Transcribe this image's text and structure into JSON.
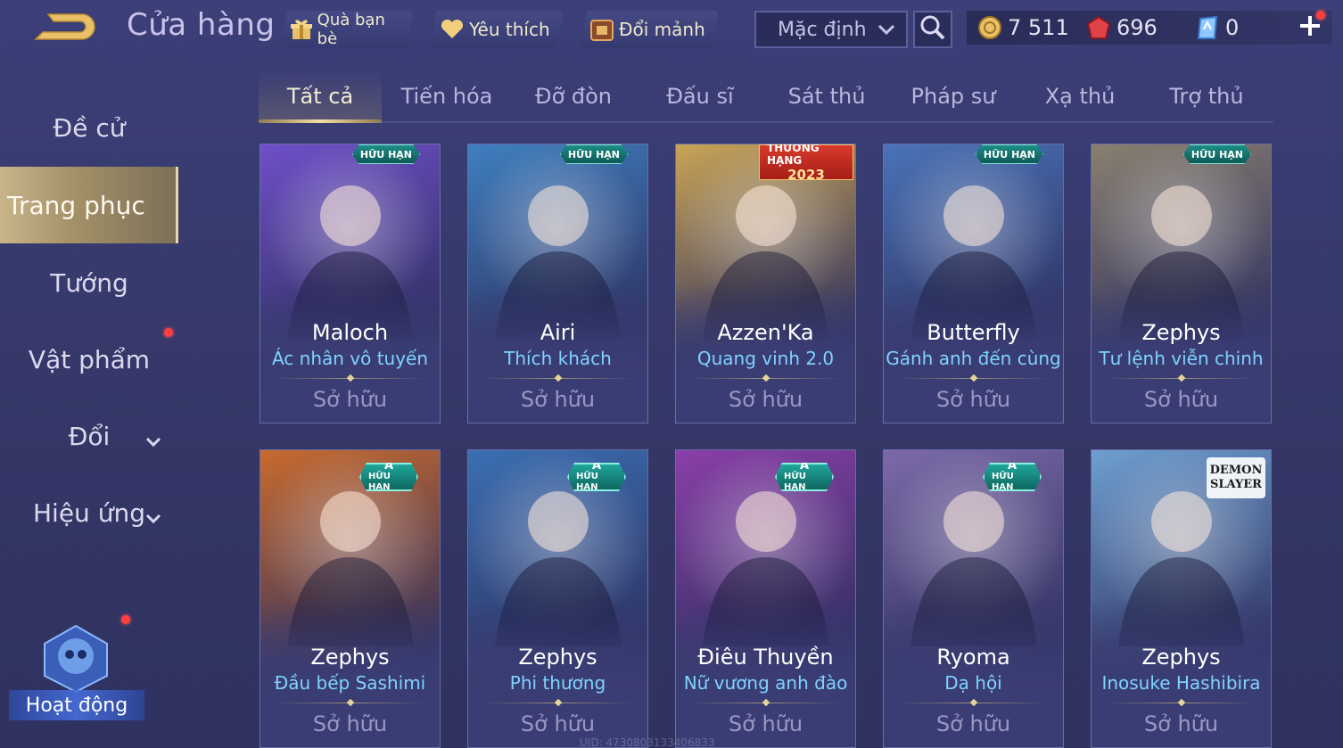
{
  "header": {
    "title": "Cửa hàng",
    "buttons": [
      {
        "label": "Quà bạn bè",
        "icon": "gift-icon"
      },
      {
        "label": "Yêu thích",
        "icon": "heart-icon"
      },
      {
        "label": "Đổi mảnh",
        "icon": "chest-icon"
      }
    ],
    "sort": {
      "value": "Mặc định"
    },
    "currencies": [
      {
        "icon": "gold-coin-icon",
        "value": "7 511"
      },
      {
        "icon": "ruby-gem-icon",
        "value": "696"
      },
      {
        "icon": "voucher-icon",
        "value": "0"
      }
    ]
  },
  "sidebar": {
    "items": [
      {
        "label": "Đề cử"
      },
      {
        "label": "Trang phục"
      },
      {
        "label": "Tướng"
      },
      {
        "label": "Vật phẩm"
      },
      {
        "label": "Đổi"
      },
      {
        "label": "Hiệu ứng"
      }
    ],
    "event_label": "Hoạt động"
  },
  "tabs": [
    "Tất cả",
    "Tiến hóa",
    "Đỡ đòn",
    "Đấu sĩ",
    "Sát thủ",
    "Pháp sư",
    "Xạ thủ",
    "Trợ thủ"
  ],
  "cards": [
    {
      "hero": "Maloch",
      "skin": "Ác nhân vô tuyến",
      "status": "Sở hữu",
      "badge": "HỮU HẠN",
      "accent": "#6f4fc8"
    },
    {
      "hero": "Airi",
      "skin": "Thích khách",
      "status": "Sở hữu",
      "badge": "HỮU HẠN",
      "accent": "#3f7fc0"
    },
    {
      "hero": "Azzen'Ka",
      "skin": "Quang vinh 2.0",
      "status": "Sở hữu",
      "badge": "THƯỞNG HẠNG",
      "badge_year": "2023",
      "accent": "#c9a455"
    },
    {
      "hero": "Butterfly",
      "skin": "Gánh anh đến cùng",
      "status": "Sở hữu",
      "badge": "HỮU HẠN",
      "accent": "#4a73b8"
    },
    {
      "hero": "Zephys",
      "skin": "Tư lệnh viễn chinh",
      "status": "Sở hữu",
      "badge": "HỮU HẠN",
      "accent": "#8a8070"
    },
    {
      "hero": "Zephys",
      "skin": "Đầu bếp Sashimi",
      "status": "Sở hữu",
      "badge": "HỮU HẠN",
      "tier": "A",
      "accent": "#c86a2e"
    },
    {
      "hero": "Zephys",
      "skin": "Phi thương",
      "status": "Sở hữu",
      "badge": "HỮU HẠN",
      "tier": "A",
      "accent": "#3b6fb3"
    },
    {
      "hero": "Điêu Thuyền",
      "skin": "Nữ vương anh đào",
      "status": "Sở hữu",
      "badge": "HỮU HẠN",
      "tier": "A",
      "accent": "#8a3fa8"
    },
    {
      "hero": "Ryoma",
      "skin": "Dạ hội",
      "status": "Sở hữu",
      "badge": "HỮU HẠN",
      "tier": "A",
      "accent": "#7c6aa8"
    },
    {
      "hero": "Zephys",
      "skin": "Inosuke Hashibira",
      "status": "Sở hữu",
      "badge": "DEMON SLAYER",
      "accent": "#6e9fd0"
    }
  ],
  "uid": "UID: 4730803133406833"
}
